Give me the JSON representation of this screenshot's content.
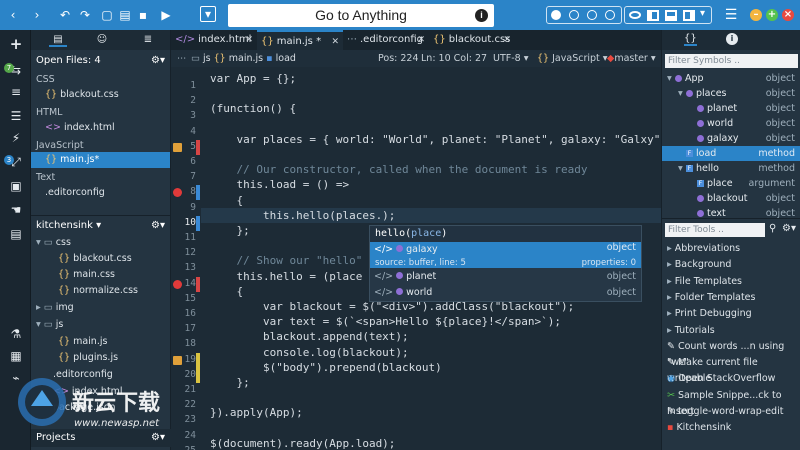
{
  "toolbar": {
    "goto_placeholder": "Go to Anything",
    "info_glyph": "i",
    "icons": {
      "back": "‹",
      "forward": "›",
      "undo": "↶",
      "redo": "↷",
      "new": "▢",
      "open": "▤",
      "save": "▪",
      "run": "▶",
      "dropdown": "▾",
      "menu": "☰",
      "minimize": "–",
      "maximize": "+",
      "close": "×"
    },
    "colors": {
      "toolbar": "#2b84c8",
      "close": "#e8493f",
      "minimize": "#f3b53f",
      "maximize": "#55c24e"
    }
  },
  "rail": {
    "icons": [
      "+",
      "⇆",
      "≡",
      "☰",
      "⚡",
      "▣",
      "☚",
      "⤢",
      "⚗",
      "▦",
      "⌁",
      "▤"
    ],
    "badges": [
      "7",
      "3"
    ]
  },
  "left_panel": {
    "open_files_label": "Open Files: 4",
    "categories": [
      {
        "name": "CSS",
        "files": [
          {
            "icon": "{}",
            "name": "blackout.css"
          }
        ]
      },
      {
        "name": "HTML",
        "files": [
          {
            "icon": "<>",
            "name": "index.html"
          }
        ]
      },
      {
        "name": "JavaScript",
        "files": [
          {
            "icon": "{}",
            "name": "main.js*"
          }
        ]
      },
      {
        "name": "Text",
        "files": [
          {
            "icon": "",
            "name": ".editorconfig"
          }
        ]
      }
    ],
    "project_label": "kitchensink",
    "tree": [
      {
        "fold": "▾",
        "icon": "▭",
        "name": "css",
        "depth": 0
      },
      {
        "fold": "",
        "icon": "{}",
        "name": "blackout.css",
        "depth": 1
      },
      {
        "fold": "",
        "icon": "{}",
        "name": "main.css",
        "depth": 1
      },
      {
        "fold": "",
        "icon": "{}",
        "name": "normalize.css",
        "depth": 1
      },
      {
        "fold": "▸",
        "icon": "▭",
        "name": "img",
        "depth": 0
      },
      {
        "fold": "▾",
        "icon": "▭",
        "name": "js",
        "depth": 0
      },
      {
        "fold": "",
        "icon": "{}",
        "name": "main.js",
        "depth": 1
      },
      {
        "fold": "",
        "icon": "{}",
        "name": "plugins.js",
        "depth": 1
      },
      {
        "fold": "",
        "icon": "",
        "name": ".editorconfig",
        "depth": 0
      },
      {
        "fold": "",
        "icon": "<>",
        "name": "index.html",
        "depth": 0
      },
      {
        "fold": "",
        "icon": "",
        "name": "package.json",
        "depth": 0
      }
    ],
    "projects_label": "Projects"
  },
  "editor": {
    "tabs": [
      {
        "icon": "</>",
        "label": "index.html",
        "active": false
      },
      {
        "icon": "{}",
        "label": "main.js",
        "active": true,
        "modified": "*"
      },
      {
        "icon": "",
        "label": ".editorconfig",
        "active": false
      },
      {
        "icon": "{}",
        "label": "blackout.css",
        "active": false
      }
    ],
    "breadcrumb": [
      "js",
      "main.js",
      "load"
    ],
    "status": {
      "pos": "Pos: 224",
      "ln": "Ln: 10 Col: 27",
      "enc": "UTF-8",
      "lang": "JavaScript",
      "branch": "master"
    },
    "lines": [
      {
        "n": "1",
        "t": "var App = {};"
      },
      {
        "n": "2",
        "t": ""
      },
      {
        "n": "3",
        "t": "(function() {"
      },
      {
        "n": "4",
        "t": ""
      },
      {
        "n": "5",
        "t": "    var places = { world: \"World\", planet: \"Planet\", galaxy: \"Galxy\" };"
      },
      {
        "n": "6",
        "t": ""
      },
      {
        "n": "7",
        "t": "    // Our constructor, called when the document is ready"
      },
      {
        "n": "8",
        "t": "    this.load = () =>"
      },
      {
        "n": "9",
        "t": "    {"
      },
      {
        "n": "10",
        "t": "        this.hello(places.);"
      },
      {
        "n": "11",
        "t": "    };"
      },
      {
        "n": "12",
        "t": ""
      },
      {
        "n": "13",
        "t": "    // Show our \"hello\" bl"
      },
      {
        "n": "14",
        "t": "    this.hello = (place ="
      },
      {
        "n": "15",
        "t": "    {"
      },
      {
        "n": "16",
        "t": "        var blackout = $(\"<div>\").addClass(\"blackout\");"
      },
      {
        "n": "17",
        "t": "        var text = $(`<span>Hello ${place}!</span>`);"
      },
      {
        "n": "18",
        "t": "        blackout.append(text);"
      },
      {
        "n": "19",
        "t": "        console.log(blackout);"
      },
      {
        "n": "20",
        "t": "        $(\"body\").prepend(blackout)"
      },
      {
        "n": "21",
        "t": "    };"
      },
      {
        "n": "22",
        "t": ""
      },
      {
        "n": "23",
        "t": "}).apply(App);"
      },
      {
        "n": "24",
        "t": ""
      },
      {
        "n": "25",
        "t": "$(document).ready(App.load);"
      }
    ],
    "autocomplete": {
      "signature_fn": "hello(",
      "signature_param": "place",
      "signature_end": ")",
      "items": [
        {
          "icon": "</>",
          "name": "galaxy",
          "type": "object",
          "source": "source: buffer, line: 5",
          "props": "properties: 0",
          "selected": true
        },
        {
          "icon": "</>",
          "name": "planet",
          "type": "object",
          "selected": false
        },
        {
          "icon": "</>",
          "name": "world",
          "type": "object",
          "selected": false
        }
      ]
    }
  },
  "right_panel": {
    "tabs": [
      "{}",
      "i"
    ],
    "filter_symbols_placeholder": "Filter Symbols ..",
    "symbols": [
      {
        "indent": 0,
        "fold": "▾",
        "kind_icon": "dot",
        "name": "App",
        "kind": "object"
      },
      {
        "indent": 1,
        "fold": "▾",
        "kind_icon": "dot",
        "name": "places",
        "kind": "object"
      },
      {
        "indent": 2,
        "fold": "",
        "kind_icon": "dot",
        "name": "planet",
        "kind": "object"
      },
      {
        "indent": 2,
        "fold": "",
        "kind_icon": "dot",
        "name": "world",
        "kind": "object"
      },
      {
        "indent": 2,
        "fold": "",
        "kind_icon": "dot",
        "name": "galaxy",
        "kind": "object"
      },
      {
        "indent": 1,
        "fold": "",
        "kind_icon": "F",
        "name": "load",
        "kind": "method",
        "selected": true
      },
      {
        "indent": 1,
        "fold": "▾",
        "kind_icon": "F",
        "name": "hello",
        "kind": "method"
      },
      {
        "indent": 2,
        "fold": "",
        "kind_icon": "F",
        "name": "place",
        "kind": "argument"
      },
      {
        "indent": 2,
        "fold": "",
        "kind_icon": "dot",
        "name": "blackout",
        "kind": "object"
      },
      {
        "indent": 2,
        "fold": "",
        "kind_icon": "dot",
        "name": "text",
        "kind": "object"
      }
    ],
    "filter_tools_placeholder": "Filter Tools ..",
    "tools": [
      {
        "icon": "▸",
        "name": "Abbreviations"
      },
      {
        "icon": "▸",
        "name": "Background"
      },
      {
        "icon": "▸",
        "name": "File Templates"
      },
      {
        "icon": "▸",
        "name": "Folder Templates"
      },
      {
        "icon": "▸",
        "name": "Print Debugging"
      },
      {
        "icon": "▸",
        "name": "Tutorials"
      },
      {
        "icon": "✎",
        "name": "Count words ...n using \"wc\""
      },
      {
        "icon": "✎",
        "name": "Make current file writeable"
      },
      {
        "icon": "◉",
        "name": "Open StackOverflow"
      },
      {
        "icon": "✂",
        "name": "Sample Snippe...ck to Insert"
      },
      {
        "icon": "✎",
        "name": "toggle-word-wrap-edit"
      },
      {
        "icon": "▪",
        "name": "Kitchensink"
      }
    ]
  },
  "watermark": {
    "brand": "新云下载",
    "url": "www.newasp.net"
  }
}
